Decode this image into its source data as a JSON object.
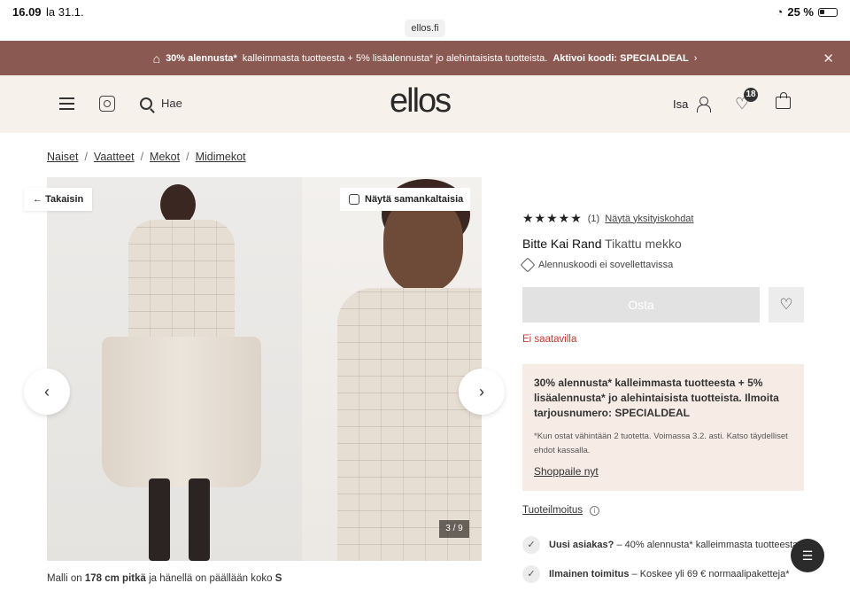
{
  "status": {
    "time": "16.09",
    "date": "la 31.1.",
    "url": "ellos.fi",
    "battery": "25 %"
  },
  "promo": {
    "part1_bold": "30% alennusta*",
    "part1": "kalleimmasta tuotteesta + 5% lisäalennusta* jo alehintaisista tuotteista.",
    "part2_bold": "Aktivoi koodi: SPECIALDEAL"
  },
  "header": {
    "logo": "ellos",
    "search_placeholder": "Hae",
    "user_name": "Isa",
    "wishlist_count": "18"
  },
  "breadcrumb": [
    "Naiset",
    "Vaatteet",
    "Mekot",
    "Midimekot"
  ],
  "gallery": {
    "back_label": "Takaisin",
    "similar_label": "Näytä samankaltaisia",
    "counter": "3 / 9",
    "model_note_a": "Malli on",
    "model_note_height": "178 cm pitkä",
    "model_note_b": "ja hänellä on päällään koko",
    "model_note_size": "S"
  },
  "product": {
    "stars": "★★★★★",
    "review_count": "(1)",
    "details_link": "Näytä yksityiskohdat",
    "brand": "Bitte Kai Rand",
    "name": "Tikattu mekko",
    "discount_note": "Alennuskoodi ei sovellettavissa",
    "buy_label": "Osta",
    "availability": "Ei saatavilla"
  },
  "offer": {
    "headline": "30% alennusta* kalleimmasta tuotteesta + 5% lisäalennusta* jo alehintaisista tuotteista. Ilmoita tarjousnumero: SPECIALDEAL",
    "fine_print": "*Kun ostat vähintään 2 tuotetta. Voimassa 3.2. asti. Katso täydelliset ehdot kassalla.",
    "link": "Shoppaile nyt"
  },
  "notice": {
    "label": "Tuoteilmoitus"
  },
  "usps": [
    {
      "bold": "Uusi asiakas?",
      "text": "– 40% alennusta* kalleimmasta tuotteesta"
    },
    {
      "bold": "Ilmainen toimitus",
      "text": "– Koskee yli 69 € normaalipaketteja*"
    }
  ]
}
